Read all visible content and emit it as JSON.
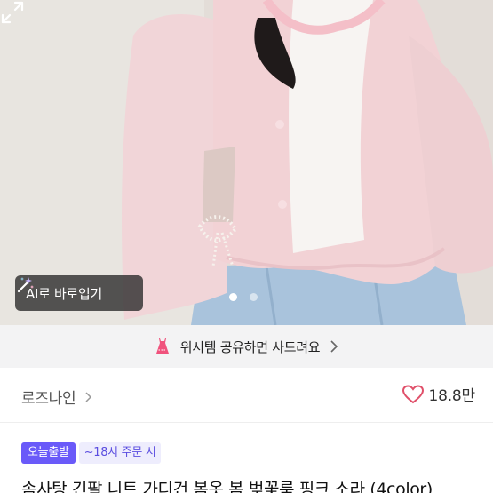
{
  "product_image": {
    "ai_button_label": "AI로 바로입기",
    "carousel": {
      "current": 1,
      "total": 2
    },
    "icons": {
      "ai": "magic-wand-icon",
      "expand": "expand-icon"
    }
  },
  "share_banner": {
    "text": "위시템 공유하면 사드려요",
    "icons": {
      "lead": "dress-icon",
      "trail": "chevron-right-icon"
    },
    "color": "#f3f3f4"
  },
  "shop": {
    "name": "로즈나인",
    "likes": "18.8만",
    "icons": {
      "like": "heart-icon",
      "name_trail": "chevron-right-icon"
    },
    "heart_color": "#e0506a"
  },
  "badges": {
    "today_shipping": "오늘출발",
    "cutoff": "~18시 주문 시",
    "accent": "#6a5af9"
  },
  "product": {
    "title": "솜사탕 긴팔 니트 가디건 봄옷 봄 벚꽃룩 핑크 소라 (4color)"
  }
}
